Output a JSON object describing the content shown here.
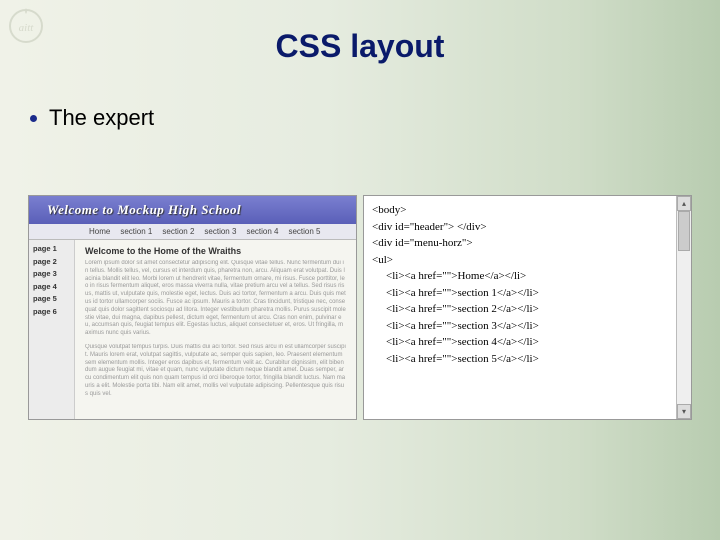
{
  "slide": {
    "title": "CSS layout",
    "bullet": "The expert"
  },
  "mockup": {
    "banner": "Welcome to Mockup High School",
    "nav": [
      "Home",
      "section 1",
      "section 2",
      "section 3",
      "section 4",
      "section 5"
    ],
    "sidebar": [
      "page 1",
      "page 2",
      "page 3",
      "page 4",
      "page 5",
      "page 6"
    ],
    "heading": "Welcome to the Home of the Wraiths",
    "para1": "Lorem ipsum dolor sit amet consectetur adipiscing elit. Quisque vitae tellus. Nunc fermentum dui in tellus. Mollis tellus, vel, cursus et interdum quis, pharetra non, arcu. Aliquam erat volutpat. Duis lacinia blandit elit leo. Morbi lorem ut hendrerit vitae, fermentum ornare, mi risus. Fusce porttitor, leo in risus fermentum aliquet, eros massa viverra nulla, vitae pretium arcu vel a tellus. Sed risus risus, mattis ut, vulputate quis, molestie eget, lectus. Duis aci tortor, fermentum a arcu. Duis quis metus id tortor ullamcorper sociis. Fusce ac ipsum. Mauris a tortor. Cras tincidunt, tristique nec, consequat quis dolor sagittent sociosqu ad litora. Integer vestibulum pharetra mollis. Purus suscipit molestie vitae, dui magna, dapibus pellest, dictum eget, fermentum ut arcu. Cras non enim, pulvinar eu, accumsan quis, feugiat tempus elit. Egestas luctus, aliquet consectetuer et, eros. Ut fringilla, maximus nunc quis varius.",
    "para2": "Quisque volutpat tempus turpis. Duis mattis dui aci tortor. Sed risus arcu in est ullamcorper suscipit. Mauris lorem erat, volutpat sagittis, vulputate ac, semper quis sapien, leo. Praesent elementum sem elementum mollis. Integer eros dapibus et, fermentum velit ac. Curabitur dignissim, elit bibendum augue feugiat mi, vitae et quam, nunc vulputate dictum neque blandit amet. Duas semper, arcu condimentum elit quis non quam tempus id orci liberoque tortor, fringilla blandit luctus. Nam mauris a elit. Molestie porta tibi. Nam elit amet, mollis vel vulputate adipiscing. Pellentesque quis risus quis vel."
  },
  "code": {
    "lines": [
      "<body>",
      "",
      "<div id=\"header\"> </div>",
      "",
      "<div id=\"menu-horz\">",
      "<ul>"
    ],
    "items": [
      "<li><a href=\"\">Home</a></li>",
      "<li><a href=\"\">section 1</a></li>",
      "<li><a href=\"\">section 2</a></li>",
      "<li><a href=\"\">section 3</a></li>",
      "<li><a href=\"\">section 4</a></li>",
      "<li><a href=\"\">section 5</a></li>"
    ]
  }
}
